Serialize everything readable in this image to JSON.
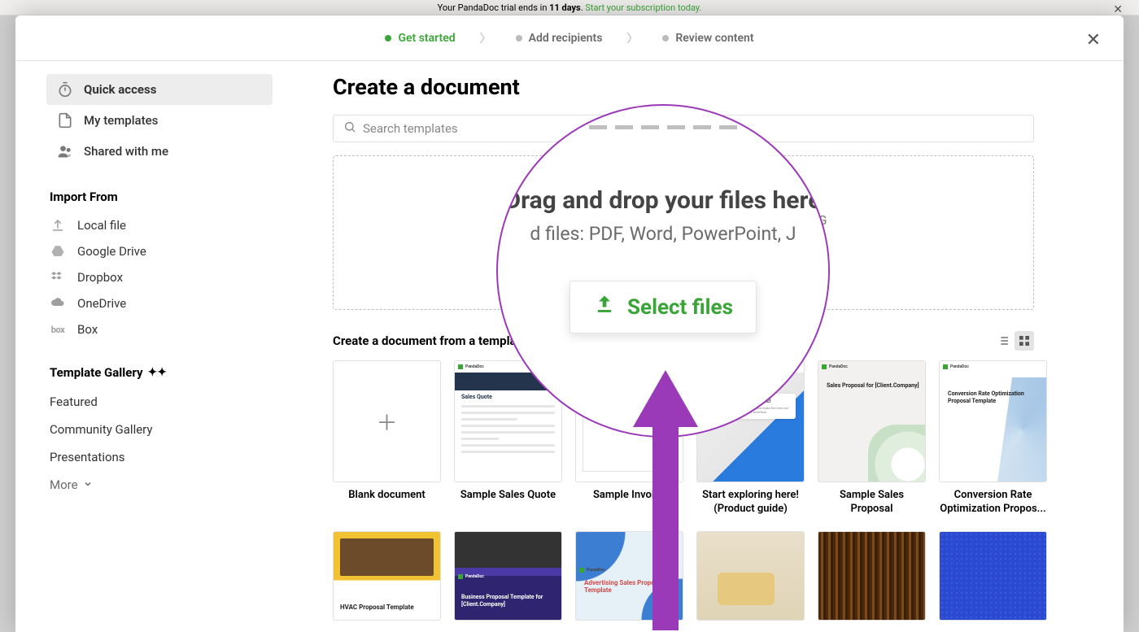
{
  "backdrop": {
    "trial_prefix": "Your PandaDoc trial ends in ",
    "trial_days": "11 days",
    "trial_suffix": ". ",
    "trial_link": "Start your subscription today."
  },
  "steps": {
    "s1": "Get started",
    "s2": "Add recipients",
    "s3": "Review content"
  },
  "sidebar": {
    "quick_access": "Quick access",
    "my_templates": "My templates",
    "shared_with_me": "Shared with me",
    "import_heading": "Import From",
    "local_file": "Local file",
    "google_drive": "Google Drive",
    "dropbox": "Dropbox",
    "onedrive": "OneDrive",
    "box": "Box",
    "gallery_heading": "Template Gallery",
    "featured": "Featured",
    "community": "Community Gallery",
    "presentations": "Presentations",
    "more": "More"
  },
  "main": {
    "title": "Create a document",
    "search_placeholder": "Search templates",
    "drop_title": "Drag and drop your files here",
    "drop_sub": "Supported files: PDF, Word, PowerPoint, JPG, PNG",
    "select_files": "Select files",
    "section_label": "Create a document from a template, or",
    "cards": {
      "blank": "Blank document",
      "quote": "Sample Sales Quote",
      "invoice": "Sample Invoice",
      "start": "Start exploring here! (Product guide)",
      "sales": "Sample Sales Proposal",
      "cro": "Conversion Rate Optimization Propos...",
      "start_banner_title": "Welcome to PandaDoc!",
      "start_banner_sub": "This product guide helps you make the best out of your new document workflow.",
      "sales_thumb_title": "Sales Proposal for [Client.Company]",
      "cro_thumb_title": "Conversion Rate Optimization Proposal Template",
      "quote_thumb_title": "Sales Quote",
      "brand_label": "PandaDoc",
      "hvac_thumb_title": "HVAC Proposal Template",
      "biz_thumb_title": "Business Proposal Template for [Client.Company]",
      "adv_thumb_title": "Advertising Sales Proposal Template"
    }
  },
  "magnifier": {
    "title": "Drag and drop your files here",
    "sub": "d files: PDF, Word, PowerPoint, J",
    "btn": "Select files"
  }
}
